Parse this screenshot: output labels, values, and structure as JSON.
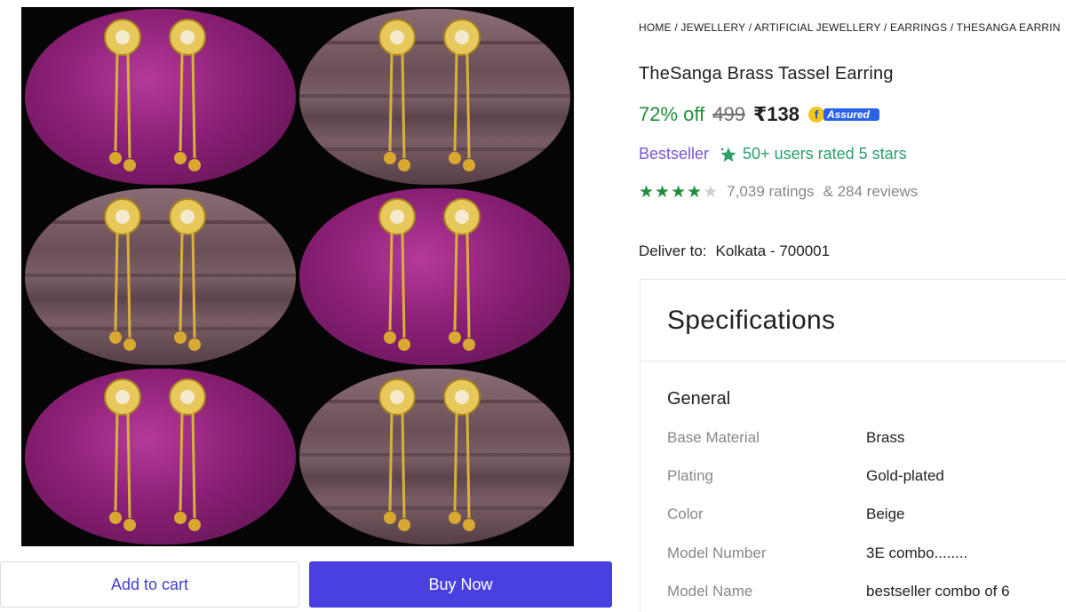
{
  "breadcrumb": [
    "HOME",
    "JEWELLERY",
    "ARTIFICIAL JEWELLERY",
    "EARRINGS",
    "THESANGA EARRIN"
  ],
  "breadcrumb_sep": " / ",
  "product": {
    "title": "TheSanga Brass Tassel Earring",
    "discount": "72% off",
    "mrp": "499",
    "price": "₹138",
    "assured_label": "Assured",
    "bestseller": "Bestseller",
    "rated_text": "50+ users rated 5 stars",
    "rating_value": 4,
    "ratings_text": "7,039 ratings",
    "reviews_text": "& 284 reviews"
  },
  "delivery": {
    "label": "Deliver to:",
    "location": "Kolkata - 700001"
  },
  "specifications": {
    "heading": "Specifications",
    "group": "General",
    "rows": [
      {
        "key": "Base Material",
        "value": "Brass"
      },
      {
        "key": "Plating",
        "value": "Gold-plated"
      },
      {
        "key": "Color",
        "value": "Beige"
      },
      {
        "key": "Model Number",
        "value": "3E combo........"
      },
      {
        "key": "Model Name",
        "value": "bestseller combo of 6"
      }
    ]
  },
  "actions": {
    "add_to_cart": "Add to cart",
    "buy_now": "Buy Now"
  },
  "colors": {
    "accent": "#4a3fe0",
    "discount": "#1f8e3a",
    "bestseller": "#7b55d6",
    "rated": "#2aa06a"
  }
}
